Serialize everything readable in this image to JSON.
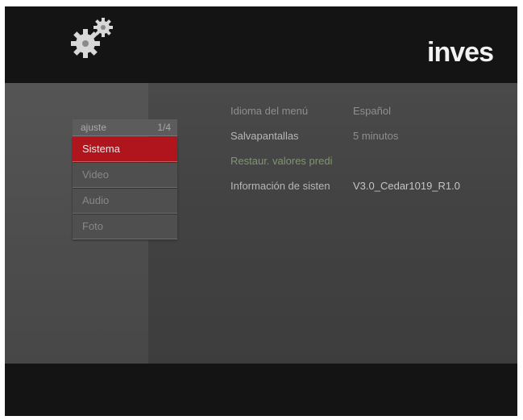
{
  "brand": {
    "logo_text": "inves"
  },
  "menu": {
    "header_label": "ajuste",
    "page_indicator": "1/4",
    "items": [
      {
        "label": "Sistema",
        "selected": true
      },
      {
        "label": "Video",
        "selected": false
      },
      {
        "label": "Audio",
        "selected": false
      },
      {
        "label": "Foto",
        "selected": false
      }
    ]
  },
  "settings": [
    {
      "key": "Idioma del menú",
      "value": "Español"
    },
    {
      "key": "Salvapantallas",
      "value": "5 minutos"
    },
    {
      "key": "Restaur. valores predi",
      "value": ""
    },
    {
      "key": "Información de sisten",
      "value": "V3.0_Cedar1019_R1.0"
    }
  ],
  "colors": {
    "selected_item": "#b0141c",
    "panel_background": "#444444",
    "bars": "#141414",
    "highlight_key": "#7f966e"
  }
}
